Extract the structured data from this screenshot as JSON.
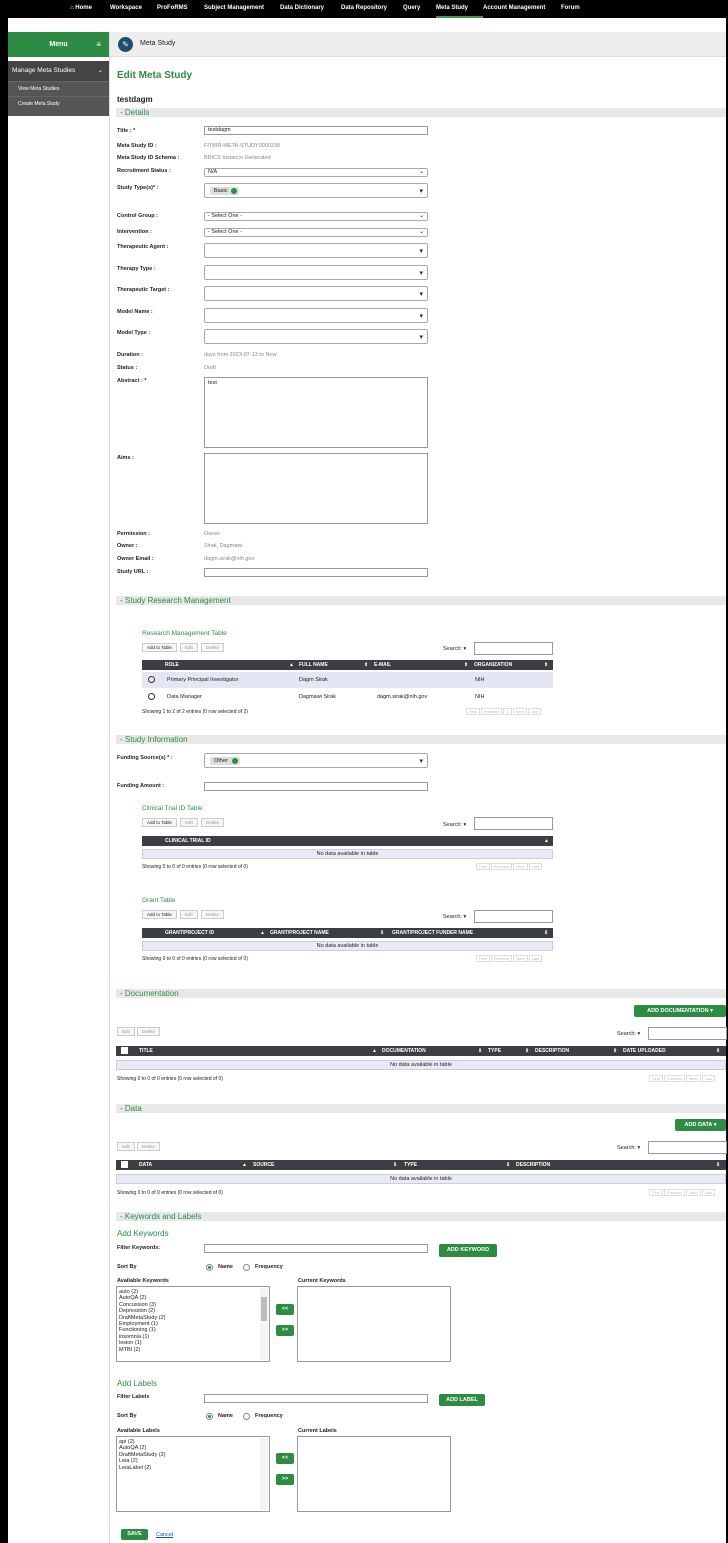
{
  "nav": {
    "items": [
      "Home",
      "Workspace",
      "ProFoRMS",
      "Subject Management",
      "Data Dictionary",
      "Data Repository",
      "Query",
      "Meta Study",
      "Account Management",
      "Forum"
    ]
  },
  "sidebar": {
    "menu": "Menu",
    "group": "Manage Meta Studies",
    "items": [
      "View Meta Studies",
      "Create Meta Study"
    ]
  },
  "breadcrumb": "Meta Study",
  "page_title": "Edit Meta Study",
  "study_name": "testdagm",
  "sections": {
    "details": "- Details",
    "srm": "- Study Research Management",
    "info": "- Study Information",
    "docs": "- Documentation",
    "data": "- Data",
    "kw": "- Keywords and Labels"
  },
  "details": {
    "title_label": "Title : *",
    "title_value": "testdagm",
    "id_label": "Meta Study ID :",
    "id_value": "FITBIR-META-STUDY0000238",
    "schema_label": "Meta Study ID Schema :",
    "schema_value": "BRICS Instance Generated",
    "recruit_label": "Recruitment Status :",
    "recruit_value": "N/A",
    "types_label": "Study Type(s)* :",
    "types_tag": "Basic",
    "control_label": "Control Group :",
    "control_value": "- Select One -",
    "intervention_label": "Intervention :",
    "intervention_value": "- Select One -",
    "agent_label": "Therapeutic Agent :",
    "therapy_label": "Therapy Type :",
    "target_label": "Therapeutic Target :",
    "model_name_label": "Model Name :",
    "model_type_label": "Model Type :",
    "duration_label": "Duration :",
    "duration_value": "days from 2023-07-13 to Now",
    "status_label": "Status :",
    "status_value": "Draft",
    "abstract_label": "Abstract : *",
    "abstract_value": "test",
    "aims_label": "Aims :",
    "permission_label": "Permission :",
    "permission_value": "Owner",
    "owner_label": "Owner :",
    "owner_value": "Sirak, Dagmawi",
    "email_label": "Owner Email :",
    "email_value": "dagm.sirak@nih.gov",
    "url_label": "Study URL :"
  },
  "common": {
    "add_to_table": "Add to Table",
    "edit": "Edit",
    "delete": "Delete",
    "search": "Search:",
    "first": "First",
    "previous": "Previous",
    "next": "Next",
    "last": "Last",
    "no_data": "No data available in table"
  },
  "rm_table": {
    "title": "Research Management Table",
    "headers": [
      "ROLE",
      "FULL NAME",
      "E-MAIL",
      "ORGANIZATION"
    ],
    "rows": [
      [
        "Primary Principal Investigator",
        "Dagm Sirak",
        "",
        "NIH"
      ],
      [
        "Data Manager",
        "Dagmawi Sirak",
        "dagm.sirak@nih.gov",
        "NIH"
      ]
    ],
    "info": "Showing 1 to 2 of 2 entries (0 row selected of 2)",
    "page": "1"
  },
  "study_info": {
    "funding_label": "Funding Source(s) * :",
    "funding_tag": "Other",
    "amount_label": "Funding Amount :"
  },
  "ct_table": {
    "title": "Clinical Trial ID Table",
    "headers": [
      "CLINICAL TRIAL ID"
    ],
    "info": "Showing 0 to 0 of 0 entries (0 row selected of 0)"
  },
  "grant_table": {
    "title": "Grant Table",
    "headers": [
      "GRANT/PROJECT ID",
      "GRANT/PROJECT NAME",
      "GRANT/PROJECT FUNDER NAME"
    ],
    "info": "Showing 0 to 0 of 0 entries (0 row selected of 0)"
  },
  "documentation": {
    "button": "ADD DOCUMENTATION",
    "headers": [
      "TITLE",
      "DOCUMENTATION",
      "TYPE",
      "DESCRIPTION",
      "DATE UPLOADED"
    ],
    "info": "Showing 0 to 0 of 0 entries (0 row selected of 0)"
  },
  "data_sec": {
    "button": "ADD DATA",
    "headers": [
      "DATA",
      "SOURCE",
      "TYPE",
      "DESCRIPTION"
    ],
    "info": "Showing 0 to 0 of 0 entries (0 row selected of 0)"
  },
  "keywords": {
    "heading": "Add Keywords",
    "filter_label": "Filter Keywords:",
    "add_button": "ADD KEYWORD",
    "sort_label": "Sort By",
    "name_opt": "Name",
    "freq_opt": "Frequency",
    "available_label": "Available Keywords",
    "current_label": "Current Keywords",
    "available": [
      "auto (2)",
      "AutoQA (2)",
      "Concussion (3)",
      "Depression (2)",
      "DraftMetaStudy (2)",
      "Employment (1)",
      "Functioning (1)",
      "insomnia (1)",
      "lesion (1)",
      "MTBI (2)"
    ]
  },
  "labels": {
    "heading": "Add Labels",
    "filter_label": "Filter Labels",
    "add_button": "ADD LABEL",
    "sort_label": "Sort By",
    "name_opt": "Name",
    "freq_opt": "Frequency",
    "available_label": "Available Labels",
    "current_label": "Current Labels",
    "available": [
      "api (2)",
      "AutoQA (2)",
      "DraftMetaStudy (2)",
      "Leia (2)",
      "LeiaLabel (2)"
    ]
  },
  "move_left": "<<",
  "move_right": ">>",
  "footer": {
    "save": "SAVE",
    "cancel": "Cancel"
  },
  "colors": {
    "accent": "#2e8b44",
    "nav_bg": "#000000",
    "table_head": "#3b3f44"
  }
}
